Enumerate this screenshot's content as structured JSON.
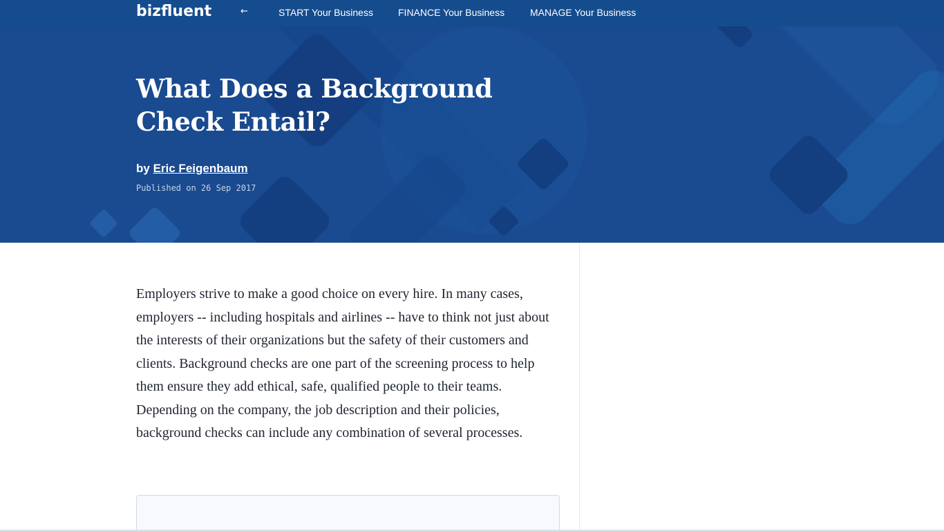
{
  "nav": {
    "logo": "bizfluent",
    "back_arrow": "←",
    "links": [
      {
        "label": "START Your Business"
      },
      {
        "label": "FINANCE Your Business"
      },
      {
        "label": "MANAGE Your Business"
      }
    ]
  },
  "article": {
    "title": "What Does a Background Check Entail?",
    "by_prefix": "by",
    "author": "Eric Feigenbaum",
    "published": "Published on 26 Sep 2017",
    "body": "Employers strive to make a good choice on every hire. In many cases, employers -- including hospitals and airlines -- have to think not just about the interests of their organizations but the safety of their customers and clients. Background checks are one part of the screening process to help them ensure they add ethical, safe, qualified people to their teams. Depending on the company, the job description and their policies, background checks can include any combination of several processes."
  },
  "colors": {
    "nav_bg": "#154c8e",
    "hero_bg": "#1a4a8f",
    "text": "#1f2430"
  }
}
